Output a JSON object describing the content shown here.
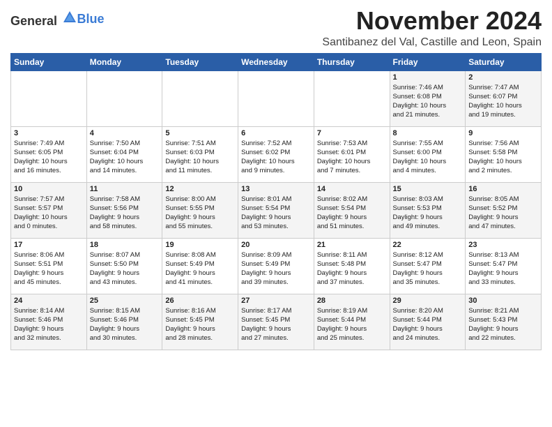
{
  "header": {
    "logo_general": "General",
    "logo_blue": "Blue",
    "month_year": "November 2024",
    "location": "Santibanez del Val, Castille and Leon, Spain"
  },
  "weekdays": [
    "Sunday",
    "Monday",
    "Tuesday",
    "Wednesday",
    "Thursday",
    "Friday",
    "Saturday"
  ],
  "weeks": [
    [
      {
        "day": "",
        "info": ""
      },
      {
        "day": "",
        "info": ""
      },
      {
        "day": "",
        "info": ""
      },
      {
        "day": "",
        "info": ""
      },
      {
        "day": "",
        "info": ""
      },
      {
        "day": "1",
        "info": "Sunrise: 7:46 AM\nSunset: 6:08 PM\nDaylight: 10 hours\nand 21 minutes."
      },
      {
        "day": "2",
        "info": "Sunrise: 7:47 AM\nSunset: 6:07 PM\nDaylight: 10 hours\nand 19 minutes."
      }
    ],
    [
      {
        "day": "3",
        "info": "Sunrise: 7:49 AM\nSunset: 6:05 PM\nDaylight: 10 hours\nand 16 minutes."
      },
      {
        "day": "4",
        "info": "Sunrise: 7:50 AM\nSunset: 6:04 PM\nDaylight: 10 hours\nand 14 minutes."
      },
      {
        "day": "5",
        "info": "Sunrise: 7:51 AM\nSunset: 6:03 PM\nDaylight: 10 hours\nand 11 minutes."
      },
      {
        "day": "6",
        "info": "Sunrise: 7:52 AM\nSunset: 6:02 PM\nDaylight: 10 hours\nand 9 minutes."
      },
      {
        "day": "7",
        "info": "Sunrise: 7:53 AM\nSunset: 6:01 PM\nDaylight: 10 hours\nand 7 minutes."
      },
      {
        "day": "8",
        "info": "Sunrise: 7:55 AM\nSunset: 6:00 PM\nDaylight: 10 hours\nand 4 minutes."
      },
      {
        "day": "9",
        "info": "Sunrise: 7:56 AM\nSunset: 5:58 PM\nDaylight: 10 hours\nand 2 minutes."
      }
    ],
    [
      {
        "day": "10",
        "info": "Sunrise: 7:57 AM\nSunset: 5:57 PM\nDaylight: 10 hours\nand 0 minutes."
      },
      {
        "day": "11",
        "info": "Sunrise: 7:58 AM\nSunset: 5:56 PM\nDaylight: 9 hours\nand 58 minutes."
      },
      {
        "day": "12",
        "info": "Sunrise: 8:00 AM\nSunset: 5:55 PM\nDaylight: 9 hours\nand 55 minutes."
      },
      {
        "day": "13",
        "info": "Sunrise: 8:01 AM\nSunset: 5:54 PM\nDaylight: 9 hours\nand 53 minutes."
      },
      {
        "day": "14",
        "info": "Sunrise: 8:02 AM\nSunset: 5:54 PM\nDaylight: 9 hours\nand 51 minutes."
      },
      {
        "day": "15",
        "info": "Sunrise: 8:03 AM\nSunset: 5:53 PM\nDaylight: 9 hours\nand 49 minutes."
      },
      {
        "day": "16",
        "info": "Sunrise: 8:05 AM\nSunset: 5:52 PM\nDaylight: 9 hours\nand 47 minutes."
      }
    ],
    [
      {
        "day": "17",
        "info": "Sunrise: 8:06 AM\nSunset: 5:51 PM\nDaylight: 9 hours\nand 45 minutes."
      },
      {
        "day": "18",
        "info": "Sunrise: 8:07 AM\nSunset: 5:50 PM\nDaylight: 9 hours\nand 43 minutes."
      },
      {
        "day": "19",
        "info": "Sunrise: 8:08 AM\nSunset: 5:49 PM\nDaylight: 9 hours\nand 41 minutes."
      },
      {
        "day": "20",
        "info": "Sunrise: 8:09 AM\nSunset: 5:49 PM\nDaylight: 9 hours\nand 39 minutes."
      },
      {
        "day": "21",
        "info": "Sunrise: 8:11 AM\nSunset: 5:48 PM\nDaylight: 9 hours\nand 37 minutes."
      },
      {
        "day": "22",
        "info": "Sunrise: 8:12 AM\nSunset: 5:47 PM\nDaylight: 9 hours\nand 35 minutes."
      },
      {
        "day": "23",
        "info": "Sunrise: 8:13 AM\nSunset: 5:47 PM\nDaylight: 9 hours\nand 33 minutes."
      }
    ],
    [
      {
        "day": "24",
        "info": "Sunrise: 8:14 AM\nSunset: 5:46 PM\nDaylight: 9 hours\nand 32 minutes."
      },
      {
        "day": "25",
        "info": "Sunrise: 8:15 AM\nSunset: 5:46 PM\nDaylight: 9 hours\nand 30 minutes."
      },
      {
        "day": "26",
        "info": "Sunrise: 8:16 AM\nSunset: 5:45 PM\nDaylight: 9 hours\nand 28 minutes."
      },
      {
        "day": "27",
        "info": "Sunrise: 8:17 AM\nSunset: 5:45 PM\nDaylight: 9 hours\nand 27 minutes."
      },
      {
        "day": "28",
        "info": "Sunrise: 8:19 AM\nSunset: 5:44 PM\nDaylight: 9 hours\nand 25 minutes."
      },
      {
        "day": "29",
        "info": "Sunrise: 8:20 AM\nSunset: 5:44 PM\nDaylight: 9 hours\nand 24 minutes."
      },
      {
        "day": "30",
        "info": "Sunrise: 8:21 AM\nSunset: 5:43 PM\nDaylight: 9 hours\nand 22 minutes."
      }
    ]
  ]
}
